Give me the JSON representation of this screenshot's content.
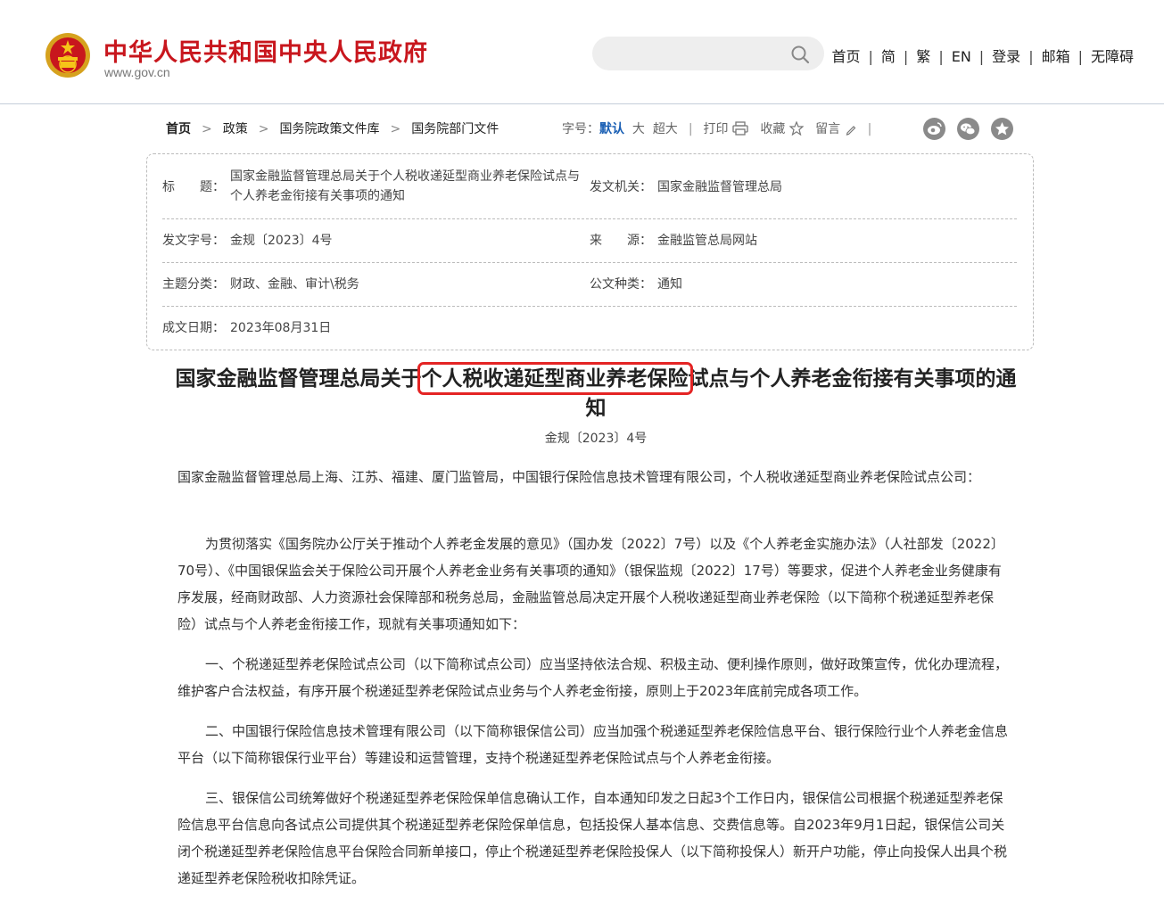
{
  "header": {
    "site_title": "中华人民共和国中央人民政府",
    "site_url": "www.gov.cn",
    "search": {
      "placeholder": ""
    },
    "nav": [
      "首页",
      "简",
      "繁",
      "EN",
      "登录",
      "邮箱",
      "无障碍"
    ]
  },
  "breadcrumb": [
    "首页",
    "政策",
    "国务院政策文件库",
    "国务院部门文件"
  ],
  "tools": {
    "font_label": "字号：",
    "font_default": "默认",
    "font_large": "大",
    "font_xlarge": "超大",
    "print": "打印",
    "favorite": "收藏",
    "comment": "留言"
  },
  "info": {
    "title_label": "标　　题：",
    "title_value": "国家金融监督管理总局关于个人税收递延型商业养老保险试点与个人养老金衔接有关事项的通知",
    "issuer_label": "发文机关：",
    "issuer_value": "国家金融监督管理总局",
    "docno_label": "发文字号：",
    "docno_value": "金规〔2023〕4号",
    "source_label": "来　　源：",
    "source_value": "金融监管总局网站",
    "topic_label": "主题分类：",
    "topic_value": "财政、金融、审计\\税务",
    "type_label": "公文种类：",
    "type_value": "通知",
    "date_label": "成文日期：",
    "date_value": "2023年08月31日"
  },
  "article": {
    "title_before": "国家金融监督管理总局关于",
    "title_highlight": "个人税收递延型商业养老保险",
    "title_after": "试点与个人养老金衔接有关事项的通知",
    "doc_number": "金规〔2023〕4号",
    "addressee": "国家金融监督管理总局上海、江苏、福建、厦门监管局，中国银行保险信息技术管理有限公司，个人税收递延型商业养老保险试点公司：",
    "paragraphs": [
      "为贯彻落实《国务院办公厅关于推动个人养老金发展的意见》（国办发〔2022〕7号）以及《个人养老金实施办法》（人社部发〔2022〕70号）、《中国银保监会关于保险公司开展个人养老金业务有关事项的通知》（银保监规〔2022〕17号）等要求，促进个人养老金业务健康有序发展，经商财政部、人力资源社会保障部和税务总局，金融监管总局决定开展个人税收递延型商业养老保险（以下简称个税递延型养老保险）试点与个人养老金衔接工作，现就有关事项通知如下：",
      "一、个税递延型养老保险试点公司（以下简称试点公司）应当坚持依法合规、积极主动、便利操作原则，做好政策宣传，优化办理流程，维护客户合法权益，有序开展个税递延型养老保险试点业务与个人养老金衔接，原则上于2023年底前完成各项工作。",
      "二、中国银行保险信息技术管理有限公司（以下简称银保信公司）应当加强个税递延型养老保险信息平台、银行保险行业个人养老金信息平台（以下简称银保行业平台）等建设和运营管理，支持个税递延型养老保险试点与个人养老金衔接。",
      "三、银保信公司统筹做好个税递延型养老保险保单信息确认工作，自本通知印发之日起3个工作日内，银保信公司根据个税递延型养老保险信息平台信息向各试点公司提供其个税递延型养老保险保单信息，包括投保人基本信息、交费信息等。自2023年9月1日起，银保信公司关闭个税递延型养老保险信息平台保险合同新单接口，停止个税递延型养老保险投保人（以下简称投保人）新开户功能，停止向投保人出具个税递延型养老保险税收扣除凭证。"
    ]
  }
}
